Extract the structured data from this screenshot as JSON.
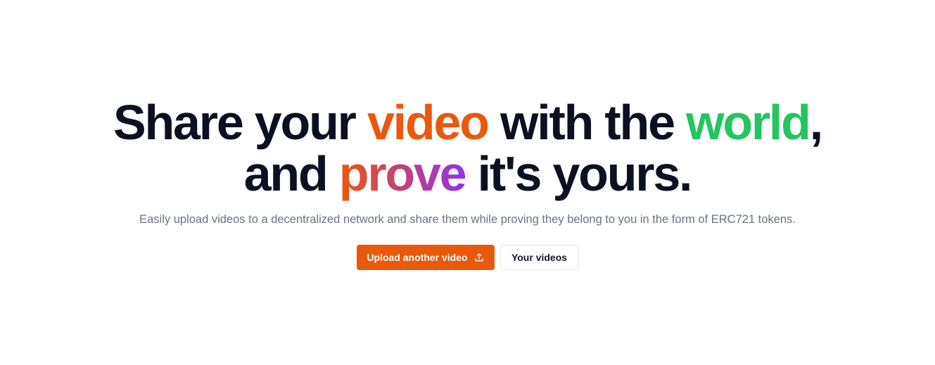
{
  "hero": {
    "headline": {
      "line1": {
        "part1": "Share your ",
        "highlight1": "video",
        "part2": " with the ",
        "highlight2": "world",
        "part3": ","
      },
      "line2": {
        "part1": "and ",
        "highlight": "prove",
        "part2": " it's yours."
      }
    },
    "subtitle": "Easily upload videos to a decentralized network and share them while proving they belong to you in the form of ERC721 tokens.",
    "buttons": {
      "upload_label": "Upload another video",
      "upload_icon": "upload-icon",
      "your_videos_label": "Your videos"
    }
  },
  "colors": {
    "accent_orange": "#ea580c",
    "accent_green": "#22c55e",
    "accent_purple": "#9333ea",
    "heading_text": "#0b1120",
    "muted_text": "#6b7280"
  }
}
